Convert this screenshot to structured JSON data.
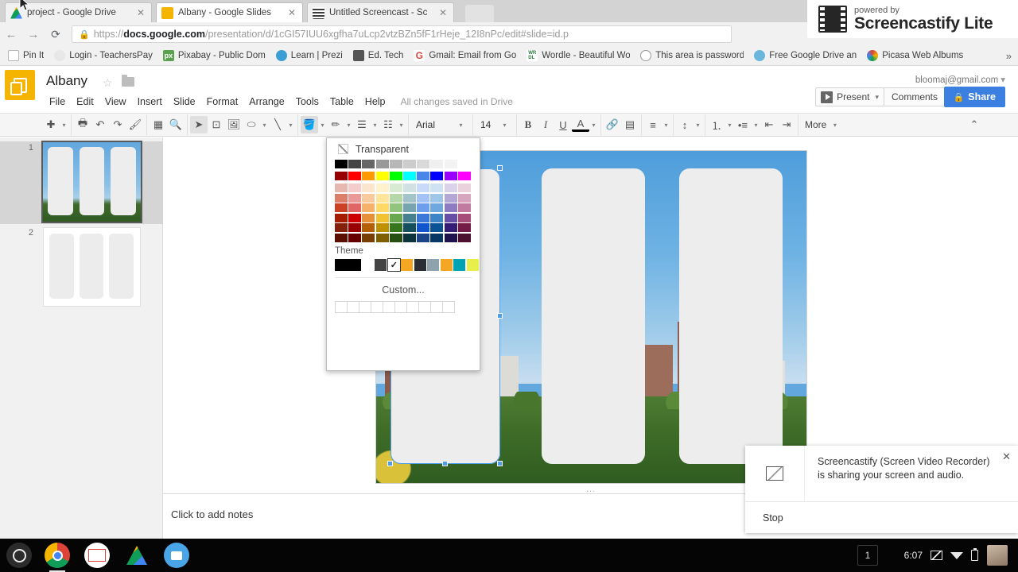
{
  "browser": {
    "tabs": [
      {
        "title": "project - Google Drive",
        "favicon": "drive-icon",
        "color": "#f4b400",
        "active": false
      },
      {
        "title": "Albany - Google Slides",
        "favicon": "slides-icon",
        "color": "#f4b400",
        "active": true
      },
      {
        "title": "Untitled Screencast - Sc",
        "favicon": "film-icon",
        "color": "#3c3c3c",
        "active": false
      }
    ],
    "nav": {
      "back": "back-icon",
      "forward": "forward-icon",
      "reload": "reload-icon"
    },
    "omnibox": {
      "lock": "lock-icon",
      "scheme": "https://",
      "host": "docs.google.com",
      "path": "/presentation/d/1cGI57IUU6xgfha7uLcp2vtzBZn5fF1rHeje_12I8nPc/edit#slide=id.p"
    },
    "bookmarks": [
      {
        "label": "Pin It",
        "icon": "page-icon",
        "color": "#ffffff"
      },
      {
        "label": "Login - TeachersPay",
        "icon": "refresh-icon",
        "color": "#e7e7e7"
      },
      {
        "label": "Pixabay - Public Dom",
        "icon": "px-icon",
        "color": "#5aa150"
      },
      {
        "label": "Learn | Prezi",
        "icon": "prezi-icon",
        "color": "#3b9fd6"
      },
      {
        "label": "Ed. Tech",
        "icon": "folder-icon",
        "color": "#555555"
      },
      {
        "label": "Gmail: Email from Go",
        "icon": "google-g-icon",
        "color": "#ffffff"
      },
      {
        "label": "Wordle - Beautiful Wo",
        "icon": "wordle-icon",
        "color": "#ffffff"
      },
      {
        "label": "This area is password",
        "icon": "globe-icon",
        "color": "#ffffff"
      },
      {
        "label": "Free Google Drive an",
        "icon": "globe-blue-icon",
        "color": "#ffffff"
      },
      {
        "label": "Picasa Web Albums",
        "icon": "picasa-icon",
        "color": "#ffffff"
      }
    ],
    "bookmarks_overflow": "»"
  },
  "screencastify_badge": {
    "powered_by": "powered by",
    "product": "Screencastify Lite",
    "icon": "film-strip-icon"
  },
  "slides": {
    "doc_title": "Albany",
    "star": "star-icon",
    "folder": "folder-icon",
    "account_email": "bloomaj@gmail.com",
    "menu": [
      "File",
      "Edit",
      "View",
      "Insert",
      "Slide",
      "Format",
      "Arrange",
      "Tools",
      "Table",
      "Help"
    ],
    "save_status": "All changes saved in Drive",
    "present_label": "Present",
    "comments_label": "Comments",
    "share_label": "Share",
    "toolbar": {
      "font_family": "Arial",
      "font_size": "14",
      "more_label": "More",
      "buttons": [
        "add-slide",
        "print",
        "undo",
        "redo",
        "paint-format",
        "layout",
        "zoom",
        "select",
        "text-box",
        "image",
        "shape",
        "line",
        "fill-color",
        "border-color",
        "border-weight",
        "border-dash",
        "bold",
        "italic",
        "underline",
        "text-color",
        "link",
        "comment",
        "align",
        "line-spacing",
        "numbered-list",
        "bulleted-list",
        "decrease-indent",
        "increase-indent",
        "collapse"
      ]
    },
    "filmstrip": [
      {
        "number": "1",
        "selected": true,
        "type": "photo-layout"
      },
      {
        "number": "2",
        "selected": false,
        "type": "blank-layout"
      }
    ],
    "notes_placeholder": "Click to add notes",
    "canvas_dots": "..."
  },
  "color_picker": {
    "transparent_label": "Transparent",
    "theme_label": "Theme",
    "custom_label": "Custom...",
    "cursor": "mouse-pointer",
    "grid": [
      [
        "#000000",
        "#434343",
        "#666666",
        "#999999",
        "#b7b7b7",
        "#cccccc",
        "#d9d9d9",
        "#efefef",
        "#f3f3f3",
        "#ffffff"
      ],
      [
        "#980000",
        "#ff0000",
        "#ff9900",
        "#ffff00",
        "#00ff00",
        "#00ffff",
        "#4a86e8",
        "#0000ff",
        "#9900ff",
        "#ff00ff"
      ],
      [
        "#e6b8af",
        "#f4cccc",
        "#fce5cd",
        "#fff2cc",
        "#d9ead3",
        "#d0e0e3",
        "#c9daf8",
        "#cfe2f3",
        "#d9d2e9",
        "#ead1dc"
      ],
      [
        "#dd7e6b",
        "#ea9999",
        "#f9cb9c",
        "#ffe599",
        "#b6d7a8",
        "#a2c4c9",
        "#a4c2f4",
        "#9fc5e8",
        "#b4a7d6",
        "#d5a6bd"
      ],
      [
        "#cc4125",
        "#e06666",
        "#f6b26b",
        "#ffd966",
        "#93c47d",
        "#76a5af",
        "#6d9eeb",
        "#6fa8dc",
        "#8e7cc3",
        "#c27ba0"
      ],
      [
        "#a61c00",
        "#cc0000",
        "#e69138",
        "#f1c232",
        "#6aa84f",
        "#45818e",
        "#3c78d8",
        "#3d85c6",
        "#674ea7",
        "#a64d79"
      ],
      [
        "#85200c",
        "#990000",
        "#b45f06",
        "#bf9000",
        "#38761d",
        "#134f5c",
        "#1155cc",
        "#0b5394",
        "#351c75",
        "#741b47"
      ],
      [
        "#5b0f00",
        "#660000",
        "#783f04",
        "#7f6000",
        "#274e13",
        "#0c343d",
        "#1c4587",
        "#073763",
        "#20124d",
        "#4c1130"
      ]
    ],
    "theme_swatches": [
      "#000000",
      "#ffffff",
      "#434343",
      "#ffffff",
      "#f5a623",
      "#2b2f33",
      "#8fa3ad",
      "#f5a623",
      "#00a3b4",
      "#e8ef4a"
    ],
    "theme_checked_index": 3,
    "theme_check_glyph": "✓",
    "custom_swatch_count": 10
  },
  "sharing_notification": {
    "message_line1": "Screencastify (Screen Video Recorder)",
    "message_line2": "is sharing your screen and audio.",
    "stop_label": "Stop",
    "close": "close-icon",
    "icon": "screen-share-icon"
  },
  "shelf": {
    "launcher": "launcher-icon",
    "apps": [
      "chrome-icon",
      "gmail-icon",
      "drive-icon",
      "camera-icon"
    ],
    "window_count": "1",
    "time": "6:07",
    "tray_icons": [
      "cast-icon",
      "wifi-icon",
      "battery-icon"
    ],
    "avatar": "user-avatar"
  }
}
